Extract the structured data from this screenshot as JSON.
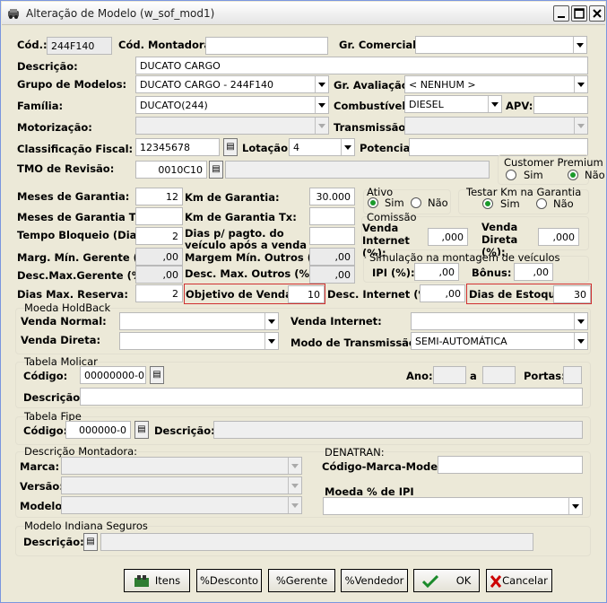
{
  "window": {
    "title": "Alteração de Modelo (w_sof_mod1)"
  },
  "cod": {
    "label": "Cód.:",
    "value": "244F140"
  },
  "cod_montadora": {
    "label": "Cód. Montadora:",
    "value": ""
  },
  "gr_comercial": {
    "label": "Gr. Comercial:",
    "value": ""
  },
  "descricao": {
    "label": "Descrição:",
    "value": "DUCATO CARGO"
  },
  "grupo_modelos": {
    "label": "Grupo de Modelos:",
    "value": "DUCATO CARGO - 244F140"
  },
  "gr_avaliacao": {
    "label": "Gr. Avaliação:",
    "value": "< NENHUM >"
  },
  "familia": {
    "label": "Família:",
    "value": "DUCATO(244)"
  },
  "combustivel": {
    "label": "Combustível:",
    "value": "DIESEL"
  },
  "apv": {
    "label": "APV:",
    "value": ""
  },
  "motorizacao": {
    "label": "Motorização:",
    "value": ""
  },
  "transmissao": {
    "label": "Transmissão:",
    "value": ""
  },
  "classificacao_fiscal": {
    "label": "Classificação Fiscal:",
    "value": "12345678"
  },
  "lotacao": {
    "label": "Lotação:",
    "value": "4"
  },
  "potencia": {
    "label": "Potencia:",
    "value": ""
  },
  "tmo_revisao": {
    "label": "TMO de Revisão:",
    "value": "0010C10",
    "desc": ""
  },
  "customer_premium": {
    "title": "Customer Premium",
    "sim": "Sim",
    "nao": "Não",
    "selected": "nao"
  },
  "meses_garantia": {
    "label": "Meses de Garantia:",
    "value": "12"
  },
  "km_garantia": {
    "label": "Km de Garantia:",
    "value": "30.000"
  },
  "ativo": {
    "title": "Ativo",
    "sim": "Sim",
    "nao": "Não",
    "selected": "sim"
  },
  "testar_km": {
    "title": "Testar Km na Garantia",
    "sim": "Sim",
    "nao": "Não",
    "selected": "sim"
  },
  "meses_garantia_tx": {
    "label": "Meses de Garantia Tx:",
    "value": ""
  },
  "km_garantia_tx": {
    "label": "Km de Garantia Tx:",
    "value": ""
  },
  "comissao": {
    "title": "Comissão",
    "venda_internet_label": "Venda Internet (%):",
    "venda_internet": ",000",
    "venda_direta_label": "Venda Direta (%):",
    "venda_direta": ",000"
  },
  "tempo_bloqueio": {
    "label": "Tempo Bloqueio (Dias):",
    "value": "2"
  },
  "dias_pagto": {
    "label1": "Dias p/ pagto. do",
    "label2": "veículo após a venda",
    "value": ""
  },
  "marg_min_gerente": {
    "label": "Marg. Mín. Gerente (%):",
    "value": ",00"
  },
  "margem_min_outros": {
    "label": "Margem Mín. Outros (%):",
    "value": ",00"
  },
  "simulacao": {
    "title": "Simulação na montagem de veículos",
    "ipi_label": "IPI (%):",
    "ipi": ",00",
    "bonus_label": "Bônus:",
    "bonus": ",00"
  },
  "desc_max_gerente": {
    "label": "Desc.Max.Gerente (%):",
    "value": ",00"
  },
  "desc_max_outros": {
    "label": "Desc. Max. Outros (%):",
    "value": ",00"
  },
  "dias_max_reserva": {
    "label": "Dias Max. Reserva:",
    "value": "2"
  },
  "objetivo_vendas": {
    "label": "Objetivo de Vendas:",
    "value": "10"
  },
  "desc_internet": {
    "label": "Desc. Internet (%):",
    "value": ",00"
  },
  "dias_estoque": {
    "label": "Dias de Estoque:",
    "value": "30"
  },
  "moeda_holdback": {
    "title": "Moeda HoldBack",
    "venda_normal": "Venda Normal:",
    "venda_direta": "Venda Direta:",
    "venda_internet": "Venda Internet:",
    "modo_transmissao": "Modo de Transmissão:",
    "modo_transmissao_value": "SEMI-AUTOMÁTICA"
  },
  "tabela_molicar": {
    "title": "Tabela Molicar",
    "codigo_label": "Código:",
    "codigo": "00000000-0",
    "ano_label": "Ano:",
    "a_label": "a",
    "portas_label": "Portas:",
    "descricao_label": "Descrição:",
    "descricao": ""
  },
  "tabela_fipe": {
    "title": "Tabela Fipe",
    "codigo_label": "Código:",
    "codigo": "000000-0",
    "descricao_label": "Descrição:",
    "descricao": ""
  },
  "descricao_montadora": {
    "title": "Descrição Montadora:",
    "marca": "Marca:",
    "versao": "Versão:",
    "modelo": "Modelo:"
  },
  "denatran": {
    "title": "DENATRAN:",
    "codigo_label": "Código-Marca-Modelo:",
    "codigo": ""
  },
  "moeda_ipi": {
    "title": "Moeda % de IPI",
    "value": ""
  },
  "indiana": {
    "title": "Modelo Indiana Seguros",
    "descricao_label": "Descrição:",
    "descricao": ""
  },
  "buttons": {
    "itens": "Itens",
    "desconto": "%Desconto",
    "gerente": "%Gerente",
    "vendedor": "%Vendedor",
    "ok": "OK",
    "cancelar": "Cancelar"
  }
}
